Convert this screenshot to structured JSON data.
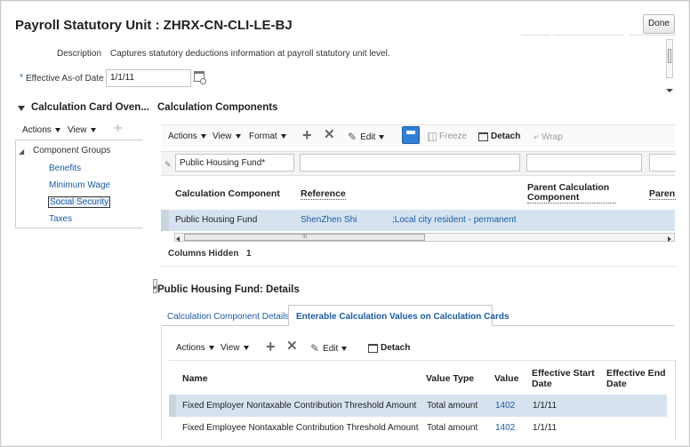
{
  "page": {
    "title": "Payroll Statutory Unit : ZHRX-CN-CLI-LE-BJ",
    "done_label": "Done"
  },
  "header": {
    "description_label": "Description",
    "description_value": "Captures statutory deductions information at payroll statutory unit level.",
    "required_mark": "*",
    "effective_label": "Effective As-of Date",
    "effective_value": "1/1/11"
  },
  "overview": {
    "title": "Calculation Card Oven...",
    "actions_label": "Actions",
    "view_label": "View",
    "group_label": "Component Groups",
    "items": [
      "Benefits",
      "Minimum Wage",
      "Social Security",
      "Taxes"
    ]
  },
  "components": {
    "title": "Calculation Components",
    "toolbar": {
      "actions": "Actions",
      "view": "View",
      "format": "Format",
      "edit": "Edit",
      "freeze": "Freeze",
      "detach": "Detach",
      "wrap": "Wrap"
    },
    "filter_value": "Public Housing Fund*",
    "columns": [
      "Calculation Component",
      "Reference",
      "Parent Calculation Component",
      "Paren"
    ],
    "row": {
      "component": "Public Housing Fund",
      "reference": "ShenZhen Shi",
      "reference_extra": ";Local city resident - permanent"
    },
    "scroll_glyph": "III",
    "columns_hidden_label": "Columns Hidden",
    "columns_hidden_value": "1"
  },
  "details": {
    "required_mark": "*",
    "title": "Public Housing Fund: Details",
    "tabs": [
      "Calculation Component Details",
      "Enterable Calculation Values on Calculation Cards"
    ],
    "toolbar": {
      "actions": "Actions",
      "view": "View",
      "edit": "Edit",
      "detach": "Detach"
    },
    "columns": [
      "Name",
      "Value Type",
      "Value",
      "Effective Start Date",
      "Effective End Date"
    ],
    "rows": [
      {
        "name": "Fixed Employer Nontaxable Contribution Threshold Amount",
        "type": "Total amount",
        "value": "1402",
        "start": "1/1/11",
        "end": ""
      },
      {
        "name": "Fixed Employee Nontaxable Contribution Threshold Amount",
        "type": "Total amount",
        "value": "1402",
        "start": "1/1/11",
        "end": ""
      }
    ]
  },
  "colors": {
    "accent": "#1a5ca8",
    "selected_row": "#d6e3ef",
    "active_icon": "#2f7fd8"
  }
}
